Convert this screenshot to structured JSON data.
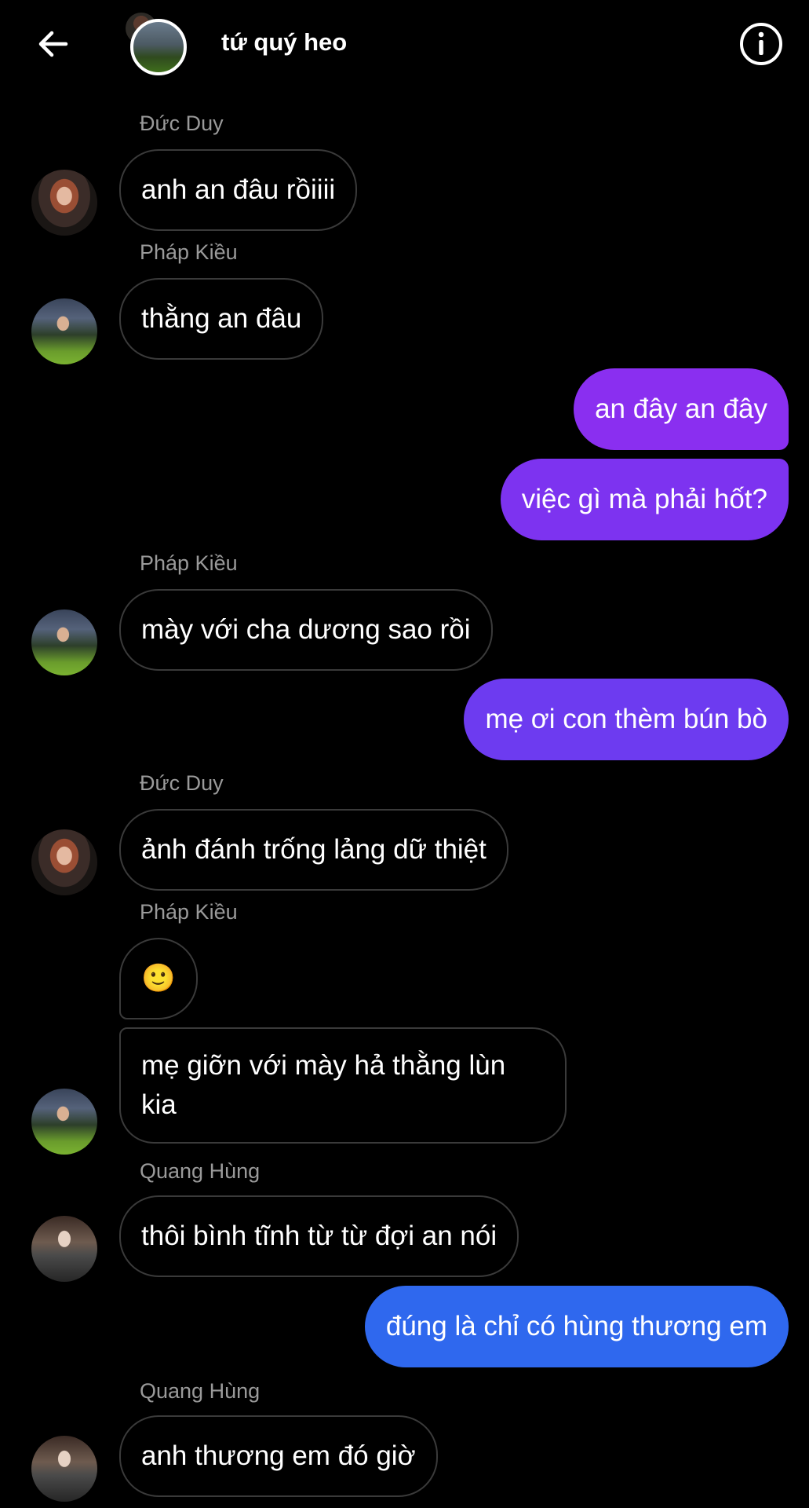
{
  "header": {
    "back_icon": "arrow-left-icon",
    "title": "tứ quý heo",
    "info_icon": "info-circle-icon"
  },
  "colors": {
    "background": "#000000",
    "incoming_border": "#3a3a3a",
    "sender_name": "#9a9a9a",
    "outgoing_purple": "#8a2ff0",
    "outgoing_violet": "#6d3bf0",
    "outgoing_blue": "#2f68ee"
  },
  "messages": [
    {
      "sender": "Đức Duy",
      "text": "anh an đâu rồiiii"
    },
    {
      "sender": "Pháp Kiều",
      "text": "thằng an đâu"
    },
    {
      "sender": "me",
      "text": "an đây an đây"
    },
    {
      "sender": "me",
      "text": "việc gì mà phải hốt?"
    },
    {
      "sender": "Pháp Kiều",
      "text": "mày với cha dương sao rồi"
    },
    {
      "sender": "me",
      "text": "mẹ ơi con thèm bún bò"
    },
    {
      "sender": "Đức Duy",
      "text": "ảnh đánh trống lảng dữ thiệt"
    },
    {
      "sender": "Pháp Kiều",
      "text": "🙂"
    },
    {
      "sender": "Pháp Kiều",
      "text": "mẹ giỡn với mày hả thằng lùn kia"
    },
    {
      "sender": "Quang Hùng",
      "text": "thôi bình tĩnh từ từ đợi an nói"
    },
    {
      "sender": "me",
      "text": "đúng là chỉ có hùng thương em"
    },
    {
      "sender": "Quang Hùng",
      "text": "anh thương em đó giờ"
    }
  ]
}
